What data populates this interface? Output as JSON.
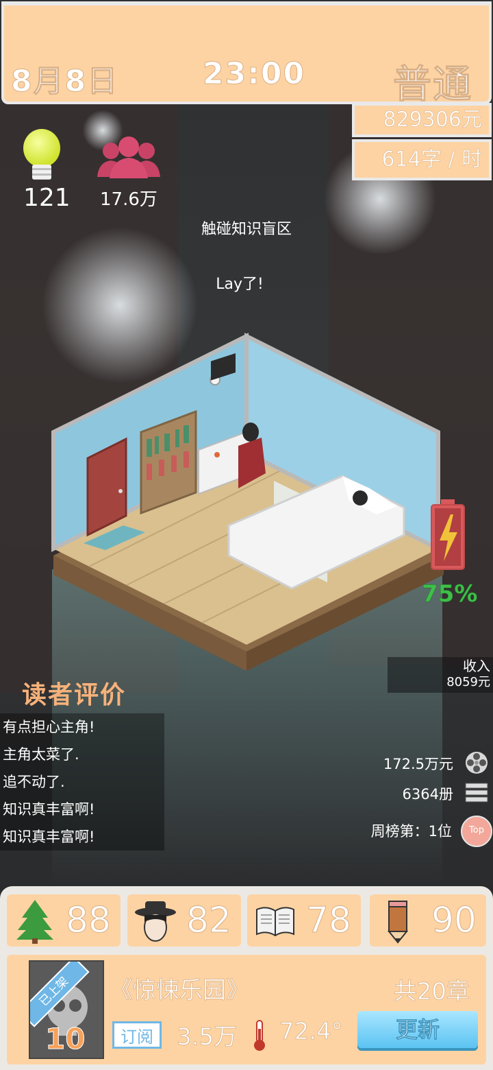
{
  "header": {
    "date": "8月8日",
    "time": "23:00",
    "mode": "普通"
  },
  "stats": {
    "money": "829306元",
    "speed": "614字 / 时"
  },
  "player": {
    "ideas": "121",
    "fans": "17.6万"
  },
  "messages": [
    "触碰知识盲区",
    "Lay了!"
  ],
  "battery": {
    "percent_label": "75%",
    "percent": 0.75
  },
  "income": {
    "label": "收入",
    "value": "8059元"
  },
  "reviews": {
    "title": "读者评价",
    "items": [
      "有点担心主角!",
      "主角太菜了.",
      "追不动了.",
      "知识真丰富啊!",
      "知识真丰富啊!"
    ]
  },
  "ranking": {
    "total_income": "172.5万元",
    "copies": "6364册",
    "weekly_rank": "周榜第：1位",
    "top_badge": "Top"
  },
  "attributes": [
    {
      "icon": "tree-icon",
      "value": "88"
    },
    {
      "icon": "detective-icon",
      "value": "82"
    },
    {
      "icon": "book-icon",
      "value": "78"
    },
    {
      "icon": "pencil-icon",
      "value": "90"
    }
  ],
  "book": {
    "status_ribbon": "已上架",
    "level": "10",
    "title": "《惊悚乐园》",
    "chapters": "共20章",
    "subscribe_label": "订阅",
    "subscribers": "3.5万",
    "heat": "72.4°",
    "update_label": "更新"
  },
  "colors": {
    "panel": "#fdd3a3",
    "accent_blue": "#6fb7e6",
    "review_title": "#f7b27a",
    "battery_green": "#3fbf4a"
  }
}
